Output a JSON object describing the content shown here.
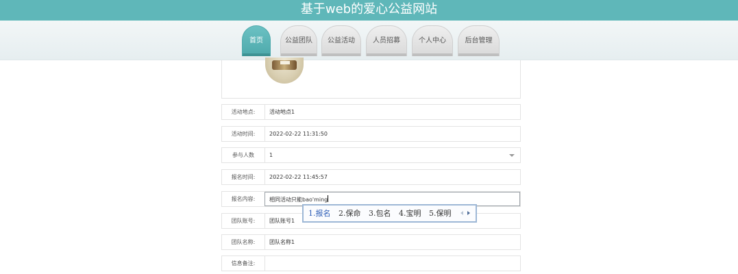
{
  "site": {
    "title": "基于web的爱心公益网站"
  },
  "nav": {
    "tabs": [
      {
        "label": "首页",
        "active": true
      },
      {
        "label": "公益团队"
      },
      {
        "label": "公益活动"
      },
      {
        "label": "人员招募"
      },
      {
        "label": "个人中心"
      },
      {
        "label": "后台管理"
      }
    ]
  },
  "form": {
    "rows": [
      {
        "label": "活动地点:",
        "value": "活动地点1"
      },
      {
        "label": "活动时间:",
        "value": "2022-02-22 11:31:50"
      },
      {
        "label": "参与人数",
        "value": "1"
      },
      {
        "label": "报名时间:",
        "value": "2022-02-22 11:45:57"
      },
      {
        "label": "报名内容:",
        "value": "相同活动只能bao'ming"
      },
      {
        "label": "团队账号:",
        "value": "团队账号1"
      },
      {
        "label": "团队名称:",
        "value": "团队名称1"
      },
      {
        "label": "信息备注:",
        "value": ""
      }
    ]
  },
  "ime": {
    "candidates": [
      "1.报名",
      "2.保命",
      "3.包名",
      "4.宝明",
      "5.保明"
    ]
  }
}
